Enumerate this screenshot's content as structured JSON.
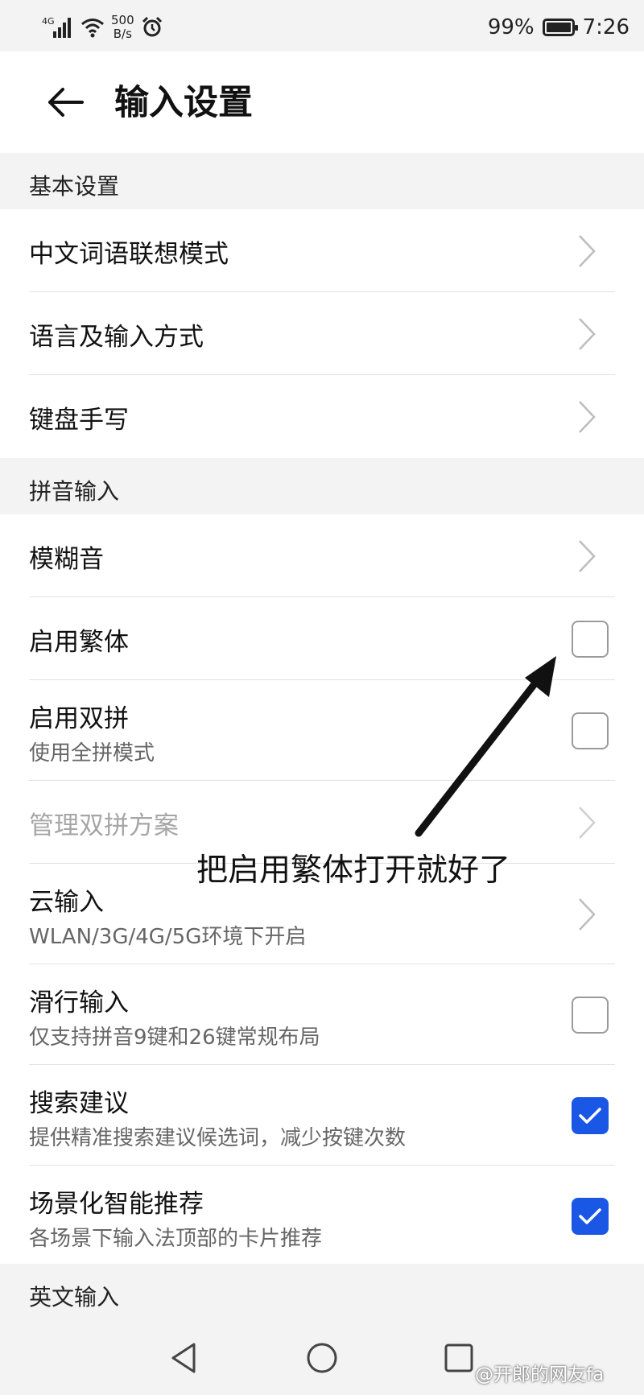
{
  "status_bar": {
    "network": "4G",
    "speed_value": "500",
    "speed_unit": "B/s",
    "battery": "99%",
    "time": "7:26"
  },
  "header": {
    "title": "输入设置"
  },
  "sections": {
    "basic": {
      "title": "基本设置",
      "items": [
        {
          "label": "中文词语联想模式",
          "control": "chevron"
        },
        {
          "label": "语言及输入方式",
          "control": "chevron"
        },
        {
          "label": "键盘手写",
          "control": "chevron"
        }
      ]
    },
    "pinyin": {
      "title": "拼音输入",
      "items": [
        {
          "label": "模糊音",
          "control": "chevron"
        },
        {
          "label": "启用繁体",
          "control": "checkbox",
          "checked": false
        },
        {
          "label": "启用双拼",
          "subtitle": "使用全拼模式",
          "control": "checkbox",
          "checked": false
        },
        {
          "label": "管理双拼方案",
          "control": "chevron",
          "disabled": true
        },
        {
          "label": "云输入",
          "subtitle": "WLAN/3G/4G/5G环境下开启",
          "control": "chevron"
        },
        {
          "label": "滑行输入",
          "subtitle": "仅支持拼音9键和26键常规布局",
          "control": "checkbox",
          "checked": false
        },
        {
          "label": "搜索建议",
          "subtitle": "提供精准搜索建议候选词，减少按键次数",
          "control": "checkbox",
          "checked": true
        },
        {
          "label": "场景化智能推荐",
          "subtitle": "各场景下输入法顶部的卡片推荐",
          "control": "checkbox",
          "checked": true
        }
      ]
    },
    "english": {
      "title": "英文输入"
    }
  },
  "annotation": {
    "text": "把启用繁体打开就好了"
  },
  "watermark": {
    "text": "@开郎的网友fa"
  },
  "colors": {
    "accent": "#1b57e5",
    "background": "#f3f3f3",
    "card": "#ffffff",
    "divider": "#e2e2e2",
    "subtitle": "#666666",
    "disabled": "#a6a6a6"
  },
  "icons": [
    "signal-icon",
    "wifi-icon",
    "alarm-icon",
    "battery-icon",
    "back-arrow-icon",
    "chevron-right-icon",
    "checkmark-icon",
    "nav-back-icon",
    "nav-home-icon",
    "nav-recents-icon"
  ]
}
